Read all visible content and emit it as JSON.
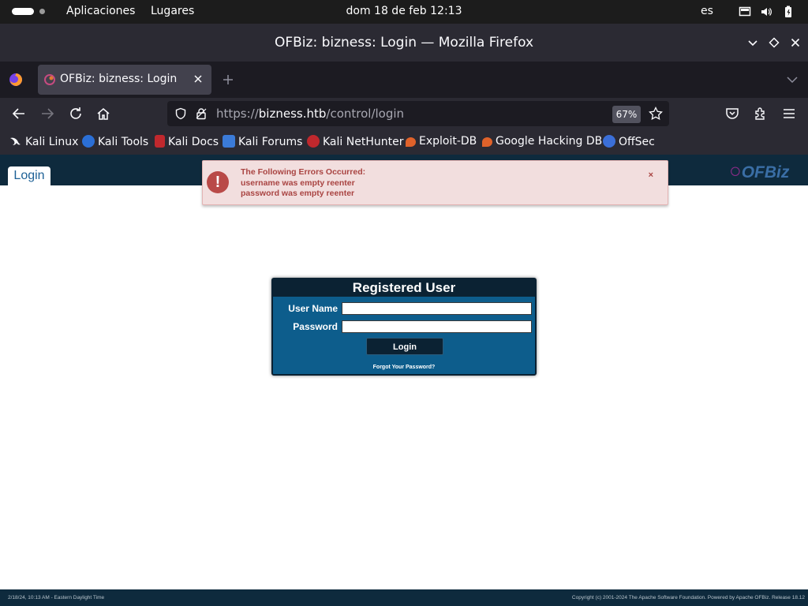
{
  "topbar": {
    "activities": "",
    "menu_apps": "Aplicaciones",
    "menu_places": "Lugares",
    "clock": "dom 18 de feb  12:13",
    "lang": "es",
    "icons": [
      "screen-icon",
      "volume-icon",
      "battery-icon"
    ]
  },
  "window": {
    "title": "OFBiz: bizness: Login — Mozilla Firefox"
  },
  "tabs": [
    {
      "label": "OFBiz: bizness: Login"
    }
  ],
  "nav": {
    "url_prefix": "https://",
    "url_host": "bizness.htb",
    "url_path": "/control/login",
    "zoom": "67%"
  },
  "bookmarks": [
    {
      "label": "Kali Linux",
      "color": "#1c1b22"
    },
    {
      "label": "Kali Tools",
      "color": "#2b6fd6"
    },
    {
      "label": "Kali Docs",
      "color": "#c0282d"
    },
    {
      "label": "Kali Forums",
      "color": "#3b7bd8"
    },
    {
      "label": "Kali NetHunter",
      "color": "#c0282d"
    },
    {
      "label": "Exploit-DB",
      "color": "#e0622a"
    },
    {
      "label": "Google Hacking DB",
      "color": "#e0622a"
    },
    {
      "label": "OffSec",
      "color": "#3b6fd8"
    }
  ],
  "page": {
    "login_tab": "Login",
    "logo": "OFBiz",
    "errors": {
      "heading": "The Following Errors Occurred:",
      "lines": [
        "username was empty reenter",
        "password was empty reenter"
      ],
      "close": "×"
    },
    "panel": {
      "title": "Registered User",
      "username_label": "User Name",
      "password_label": "Password",
      "login_button": "Login",
      "forgot_link": "Forgot Your Password?"
    },
    "footer_left": "2/18/24, 10:13 AM - Eastern Daylight Time",
    "footer_right": "Copyright (c) 2001-2024 The Apache Software Foundation. Powered by Apache OFBiz. Release 18.12"
  },
  "colors": {
    "ofbiz_header": "#0e2a3d",
    "panel": "#0d5d8c",
    "error_bg": "#f2dede",
    "error_text": "#a94442"
  }
}
